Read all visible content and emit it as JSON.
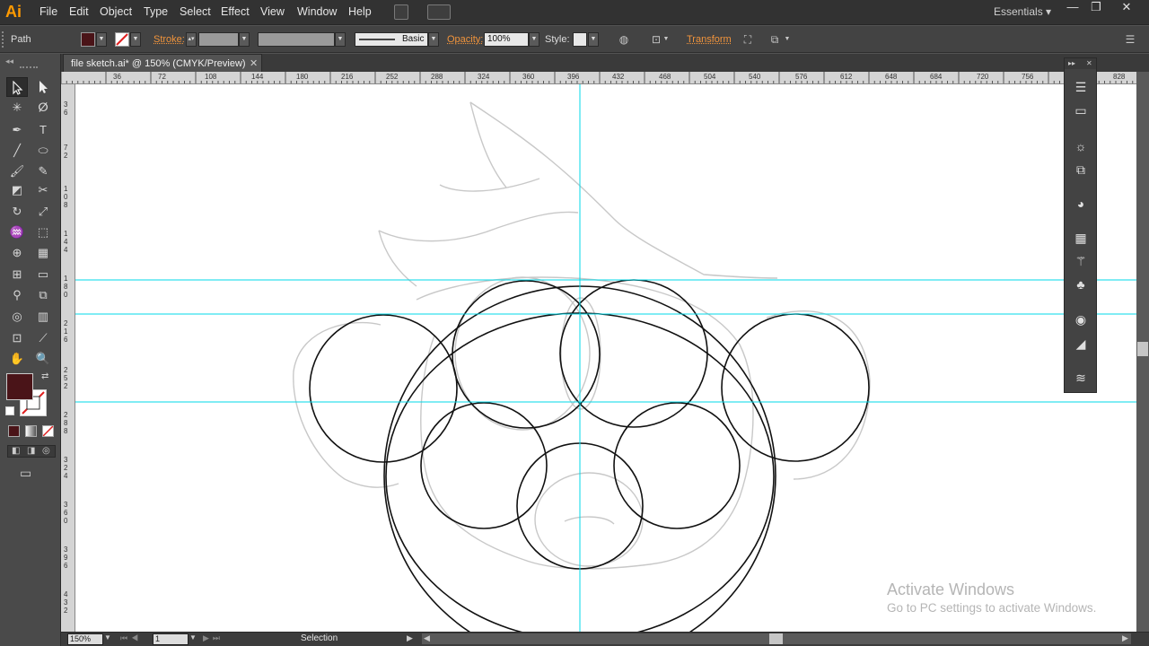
{
  "app": {
    "logo": "Ai",
    "workspace": "Essentials"
  },
  "menu": [
    "File",
    "Edit",
    "Object",
    "Type",
    "Select",
    "Effect",
    "View",
    "Window",
    "Help"
  ],
  "window_controls": [
    "—",
    "❐",
    "✕"
  ],
  "control_bar": {
    "object_type": "Path",
    "fill_color": "#4a1418",
    "stroke_label": "Stroke:",
    "brush_label": "Basic",
    "opacity_label": "Opacity:",
    "opacity_value": "100%",
    "style_label": "Style:",
    "transform_label": "Transform"
  },
  "document": {
    "tab_title": "file sketch.ai* @ 150% (CMYK/Preview)",
    "close": "✕"
  },
  "ruler_top_labels": [
    "36",
    "72",
    "108",
    "144",
    "180",
    "216",
    "252",
    "288",
    "324",
    "360",
    "396",
    "432",
    "468",
    "504",
    "540",
    "576",
    "612",
    "648",
    "684",
    "720",
    "756",
    "828"
  ],
  "ruler_left_labels": [
    "3\n6",
    "7\n2",
    "1\n0\n8",
    "1\n4\n4",
    "1\n8\n0",
    "2\n1\n6",
    "2\n5\n2",
    "2\n8\n8",
    "3\n2\n4",
    "3\n6\n0",
    "3\n9\n6",
    "4\n3\n2"
  ],
  "status": {
    "zoom": "150%",
    "page": "1",
    "tool": "Selection"
  },
  "watermark": {
    "line1": "Activate Windows",
    "line2": "Go to PC settings to activate Windows."
  },
  "colors": {
    "guide": "#00d8e8",
    "accent": "#f1943c",
    "fill": "#4a1418"
  },
  "icons": {
    "tools": [
      "selection-tool-icon",
      "direct-selection-tool-icon",
      "magic-wand-icon",
      "lasso-icon",
      "pen-icon",
      "type-icon",
      "line-segment-icon",
      "ellipse-icon",
      "paintbrush-icon",
      "pencil-icon",
      "eraser-icon",
      "scissors-icon",
      "rotate-icon",
      "scale-icon",
      "warp-icon",
      "free-transform-icon",
      "shape-builder-icon",
      "perspective-grid-icon",
      "mesh-icon",
      "gradient-icon",
      "eyedropper-icon",
      "blend-icon",
      "symbol-sprayer-icon",
      "column-graph-icon",
      "artboard-icon",
      "slice-icon",
      "hand-icon",
      "zoom-icon"
    ],
    "dock": [
      "color-guide-icon",
      "gradient-panel-icon",
      "appearance-icon",
      "transform-panel-icon",
      "pathfinder-icon",
      "swatches-icon",
      "brushes-icon",
      "symbols-icon",
      "graphic-styles-icon",
      "transparency-icon",
      "layers-icon"
    ]
  }
}
